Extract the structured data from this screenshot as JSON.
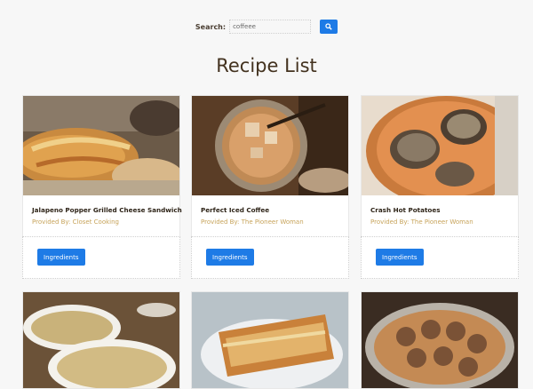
{
  "search": {
    "label": "Search:",
    "value": "coffeee",
    "icon": "search-icon"
  },
  "page_title": "Recipe List",
  "cards": [
    {
      "title": "Jalapeno Popper Grilled Cheese Sandwich",
      "provider": "Provided By: Closet Cooking",
      "button": "Ingredients",
      "image": "grilled-cheese-photo"
    },
    {
      "title": "Perfect Iced Coffee",
      "provider": "Provided By: The Pioneer Woman",
      "button": "Ingredients",
      "image": "iced-coffee-photo"
    },
    {
      "title": "Crash Hot Potatoes",
      "provider": "Provided By: The Pioneer Woman",
      "button": "Ingredients",
      "image": "potatoes-photo"
    }
  ],
  "colors": {
    "accent": "#1e7be6",
    "provider": "#c7a35a",
    "title": "#43321f"
  }
}
